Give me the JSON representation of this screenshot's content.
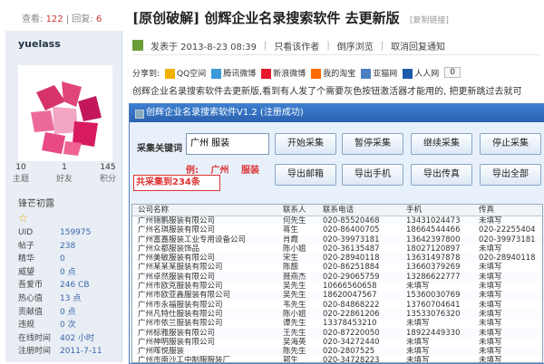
{
  "topbar": {
    "views_label": "查看:",
    "views_count": "122",
    "reply_label": "回复:",
    "reply_count": "6",
    "title": "[原创破解] 创辉企业名录搜索软件 去更新版",
    "copy_link": "[复制链接]"
  },
  "sidebar": {
    "username": "yuelass",
    "stats": [
      {
        "value": "10",
        "label": "主题"
      },
      {
        "value": "1",
        "label": "好友"
      },
      {
        "value": "145",
        "label": "积分"
      }
    ],
    "badge": "锋芒初露",
    "star": "☆",
    "info": [
      {
        "k": "UID",
        "v": "159975"
      },
      {
        "k": "帖子",
        "v": "238"
      },
      {
        "k": "精华",
        "v": "0"
      },
      {
        "k": "威望",
        "v": "0 点"
      },
      {
        "k": "吾爱币",
        "v": "246 CB"
      },
      {
        "k": "热心值",
        "v": "13 点"
      },
      {
        "k": "贡献值",
        "v": "0 点"
      },
      {
        "k": "违规",
        "v": "0 次"
      },
      {
        "k": "在线时间",
        "v": "402 小时"
      },
      {
        "k": "注册时间",
        "v": "2011-7-11"
      }
    ]
  },
  "post": {
    "posted_at": "发表于 2013-8-23 08:39",
    "only_author": "只看该作者",
    "order": "倒序浏览",
    "cancel_notify": "取消回复通知",
    "share_label": "分享到:",
    "share_items": [
      "QQ空间",
      "腾讯微博",
      "新浪微博",
      "我的淘宝",
      "亚猫网",
      "人人网"
    ],
    "share_count": "0",
    "text": "创辉企业名录搜索软件去更新版,看到有人发了个需要灰色按钮激活器才能用的, 把更新跳过去就可"
  },
  "app": {
    "window_title": "创辉企业名录搜索软件V1.2 (注册成功)",
    "keyword_label": "采集关键词",
    "keyword_value": "广州 服装",
    "example": "例: 广州 服装",
    "collected": "共采集到234条",
    "buttons": {
      "start": "开始采集",
      "pause": "暂停采集",
      "resume": "继续采集",
      "stop": "停止采集",
      "export_email": "导出邮箱",
      "export_mobile": "导出手机",
      "export_fax": "导出传真",
      "export_all": "导出全部"
    },
    "columns": [
      "公司名称",
      "联系人",
      "联系电话",
      "手机",
      "传真"
    ],
    "rows": [
      [
        "广州锦鹏服装有限公司",
        "何先生",
        "020-85520468",
        "13431024473",
        "未填写"
      ],
      [
        "广州名琪服装有限公司",
        "蒋生",
        "020-86400705",
        "18664544466",
        "020-22255404"
      ],
      [
        "广州富嘉服装工业专用设备公司",
        "肖霞",
        "020-39973181",
        "13642397800",
        "020-39973181"
      ],
      [
        "广州众都服装饰品",
        "陈小姐",
        "020-36135487",
        "18027120897",
        "未填写"
      ],
      [
        "广州美敏服装有限公司",
        "宋生",
        "020-28940118",
        "13631497878",
        "020-28940118"
      ],
      [
        "广州某某某服装有限公司",
        "陈靓",
        "020-86251884",
        "13660379269",
        "未填写"
      ],
      [
        "广州卓然服装有限公司",
        "聂燕杰",
        "020-29065759",
        "13286622777",
        "未填写"
      ],
      [
        "广州市欧克服装有限公司",
        "吴先生",
        "10666560658",
        "未填写",
        "未填写"
      ],
      [
        "广州市欧亚鑫服装有限公司",
        "吴先生",
        "18620047567",
        "15360030769",
        "未填写"
      ],
      [
        "广州市永福服装有限公司",
        "韦先生",
        "020-84868222",
        "13760704641",
        "未填写"
      ],
      [
        "广州凡特仕服装有限公司",
        "陈小姐",
        "020-22861206",
        "13533076320",
        "未填写"
      ],
      [
        "广州市依兰服装有限公司",
        "谭先生",
        "13378453210",
        "未填写",
        "未填写"
      ],
      [
        "广州标雅服装有限公司",
        "王先生",
        "020-87220050",
        "18922449330",
        "未填写"
      ],
      [
        "广州神明服装有限公司",
        "吴海英",
        "020-34272440",
        "未填写",
        "未填写"
      ],
      [
        "广州晖悦服装",
        "陈先生",
        "020-2807525",
        "未填写",
        "未填写"
      ],
      [
        "广州市南沙工中制服服装厂",
        "郭生",
        "020-34728223",
        "未填写",
        "未填写"
      ]
    ]
  }
}
